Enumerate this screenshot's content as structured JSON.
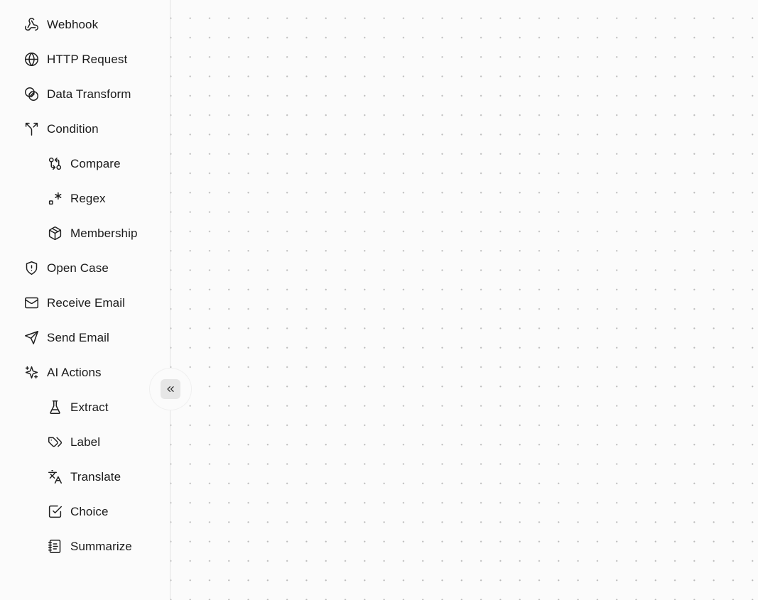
{
  "sidebar": {
    "items": [
      {
        "label": "Webhook",
        "icon": "webhook-icon",
        "level": 0
      },
      {
        "label": "HTTP Request",
        "icon": "globe-icon",
        "level": 0
      },
      {
        "label": "Data Transform",
        "icon": "blend-icon",
        "level": 0
      },
      {
        "label": "Condition",
        "icon": "split-icon",
        "level": 0
      },
      {
        "label": "Compare",
        "icon": "git-compare-icon",
        "level": 1
      },
      {
        "label": "Regex",
        "icon": "regex-icon",
        "level": 1
      },
      {
        "label": "Membership",
        "icon": "box-icon",
        "level": 1
      },
      {
        "label": "Open Case",
        "icon": "shield-alert-icon",
        "level": 0
      },
      {
        "label": "Receive Email",
        "icon": "mail-icon",
        "level": 0
      },
      {
        "label": "Send Email",
        "icon": "send-icon",
        "level": 0
      },
      {
        "label": "AI Actions",
        "icon": "sparkles-icon",
        "level": 0
      },
      {
        "label": "Extract",
        "icon": "flask-icon",
        "level": 1
      },
      {
        "label": "Label",
        "icon": "tags-icon",
        "level": 1
      },
      {
        "label": "Translate",
        "icon": "languages-icon",
        "level": 1
      },
      {
        "label": "Choice",
        "icon": "check-square-icon",
        "level": 1
      },
      {
        "label": "Summarize",
        "icon": "notebook-icon",
        "level": 1
      }
    ],
    "collapse_icon": "chevrons-left-icon"
  },
  "canvas": {
    "background": "dot-grid",
    "dot_color": "#b9b9b9"
  },
  "colors": {
    "background": "#fbfbfb",
    "text": "#1a1a1a",
    "divider": "#e3e3e3",
    "button_bg": "#e6e6e6"
  }
}
